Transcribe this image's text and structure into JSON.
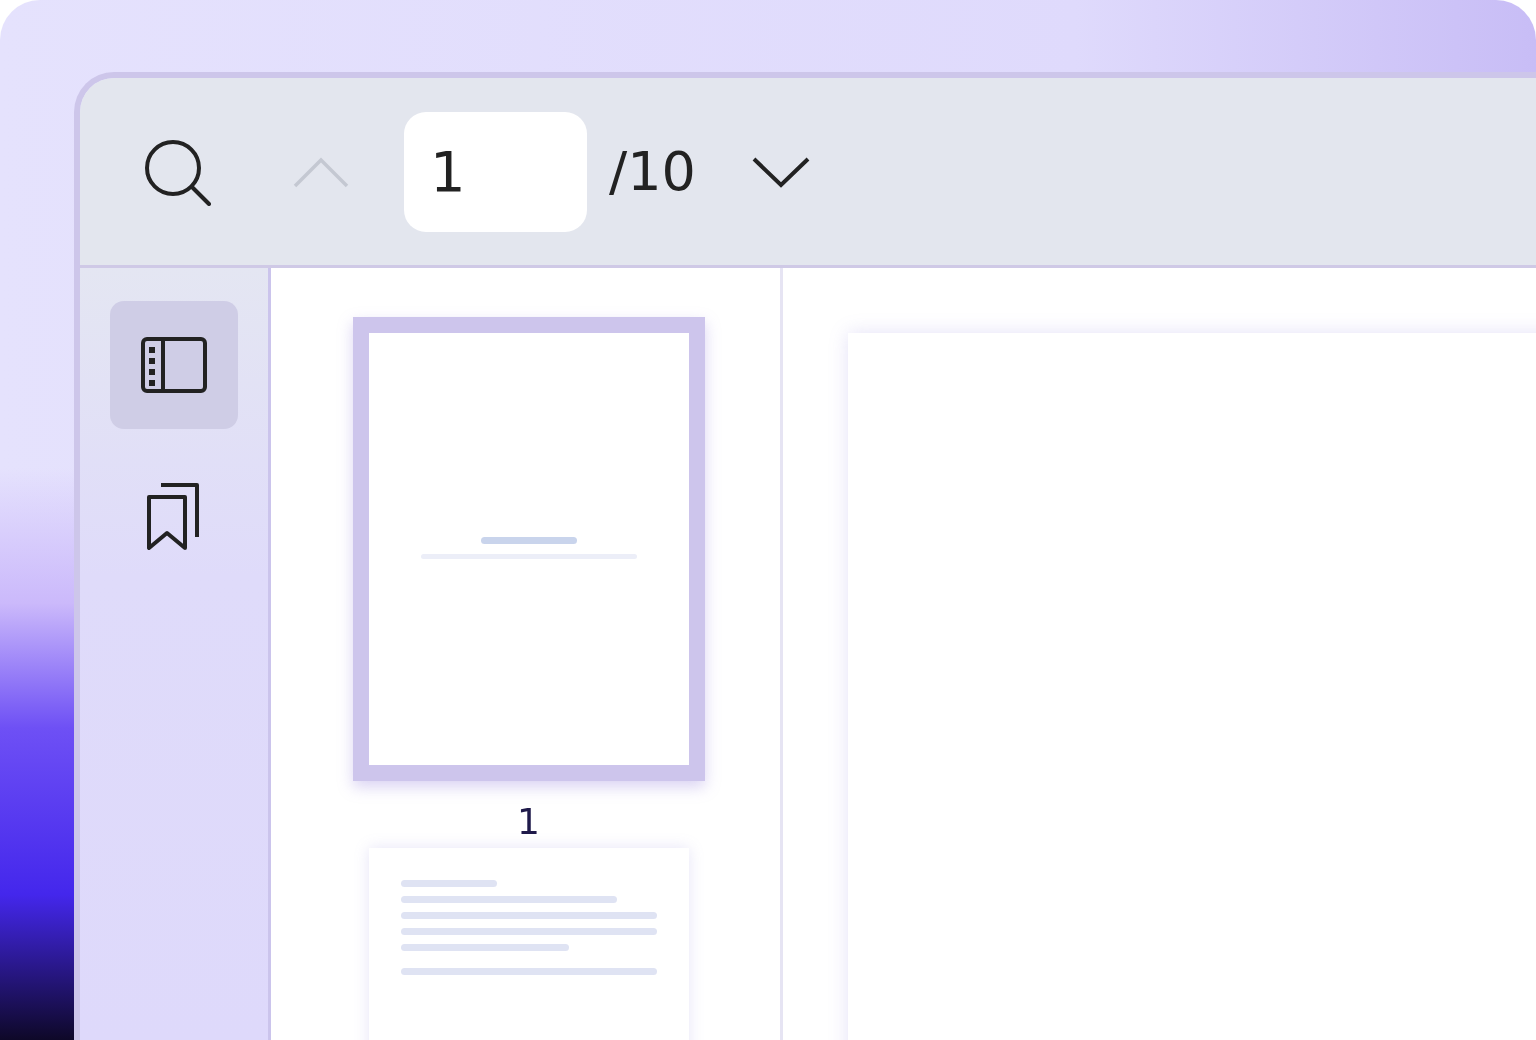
{
  "toolbar": {
    "search": {
      "kind": "search"
    },
    "previous_page": {
      "disabled": true
    },
    "page_input": {
      "value": "1"
    },
    "page_total": "/10",
    "next_page": {
      "disabled": false
    }
  },
  "sidebar": {
    "items": [
      {
        "kind": "thumbnails",
        "selected": true
      },
      {
        "kind": "bookmarks",
        "selected": false
      }
    ]
  },
  "thumbnails": [
    {
      "kind": "title",
      "label": "1",
      "selected": true
    },
    {
      "kind": "text",
      "selected": false
    }
  ]
}
